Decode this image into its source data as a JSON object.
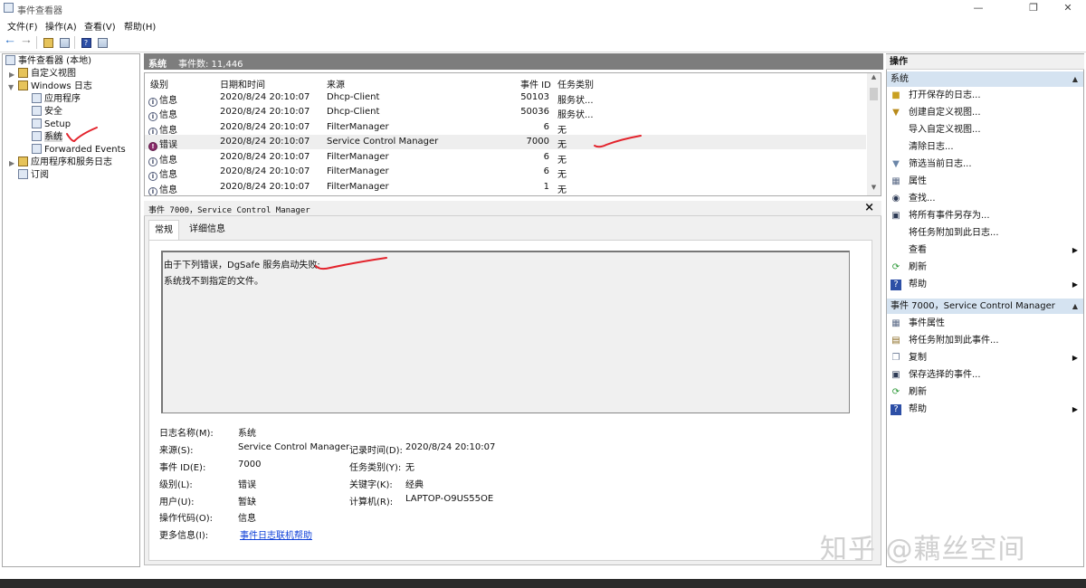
{
  "window": {
    "title": "事件查看器"
  },
  "menu": [
    "文件(F)",
    "操作(A)",
    "查看(V)",
    "帮助(H)"
  ],
  "tree": {
    "root": "事件查看器 (本地)",
    "custom_views": "自定义视图",
    "windows_logs": "Windows 日志",
    "application": "应用程序",
    "security": "安全",
    "setup": "Setup",
    "system": "系统",
    "forwarded": "Forwarded Events",
    "apps_services": "应用程序和服务日志",
    "subscriptions": "订阅"
  },
  "center": {
    "title": "系统",
    "count": "事件数: 11,446"
  },
  "list": {
    "headers": {
      "level": "级别",
      "datetime": "日期和时间",
      "source": "来源",
      "event_id": "事件 ID",
      "task": "任务类别"
    },
    "rows": [
      {
        "level": "信息",
        "datetime": "2020/8/24 20:10:07",
        "source": "Dhcp-Client",
        "event_id": "50103",
        "task": "服务状..."
      },
      {
        "level": "信息",
        "datetime": "2020/8/24 20:10:07",
        "source": "Dhcp-Client",
        "event_id": "50036",
        "task": "服务状..."
      },
      {
        "level": "信息",
        "datetime": "2020/8/24 20:10:07",
        "source": "FilterManager",
        "event_id": "6",
        "task": "无"
      },
      {
        "level": "错误",
        "datetime": "2020/8/24 20:10:07",
        "source": "Service Control Manager",
        "event_id": "7000",
        "task": "无"
      },
      {
        "level": "信息",
        "datetime": "2020/8/24 20:10:07",
        "source": "FilterManager",
        "event_id": "6",
        "task": "无"
      },
      {
        "level": "信息",
        "datetime": "2020/8/24 20:10:07",
        "source": "FilterManager",
        "event_id": "6",
        "task": "无"
      },
      {
        "level": "信息",
        "datetime": "2020/8/24 20:10:07",
        "source": "FilterManager",
        "event_id": "1",
        "task": "无"
      }
    ]
  },
  "detail": {
    "header": "事件 7000，Service Control Manager",
    "tabs": [
      "常规",
      "详细信息"
    ],
    "message": [
      "由于下列错误，DgSafe 服务启动失败:",
      "系统找不到指定的文件。"
    ],
    "labels": {
      "log_name": "日志名称(M):",
      "source": "来源(S):",
      "event_id": "事件 ID(E):",
      "level": "级别(L):",
      "user": "用户(U):",
      "opcode": "操作代码(O):",
      "more": "更多信息(I):",
      "logged": "记录时间(D):",
      "task": "任务类别(Y):",
      "keywords": "关键字(K):",
      "computer": "计算机(R):"
    },
    "values": {
      "log_name": "系统",
      "source": "Service Control Manager",
      "event_id": "7000",
      "level": "错误",
      "user": "暂缺",
      "opcode": "信息",
      "more": "事件日志联机帮助",
      "logged": "2020/8/24 20:10:07",
      "task": "无",
      "keywords": "经典",
      "computer": "LAPTOP-O9US55OE"
    }
  },
  "actions": {
    "title": "操作",
    "group1": "系统",
    "items1": [
      "打开保存的日志...",
      "创建自定义视图...",
      "导入自定义视图...",
      "清除日志...",
      "筛选当前日志...",
      "属性",
      "查找...",
      "将所有事件另存为...",
      "将任务附加到此日志...",
      "查看",
      "刷新",
      "帮助"
    ],
    "group2": "事件 7000，Service Control Manager",
    "items2": [
      "事件属性",
      "将任务附加到此事件...",
      "复制",
      "保存选择的事件...",
      "刷新",
      "帮助"
    ]
  },
  "watermark": "知乎 @藕丝空间",
  "colors": {
    "header_gray": "#7d7d7d",
    "group_blue": "#d5e3f1",
    "annotation_red": "#e3232c",
    "link_blue": "#0d3fd8"
  }
}
